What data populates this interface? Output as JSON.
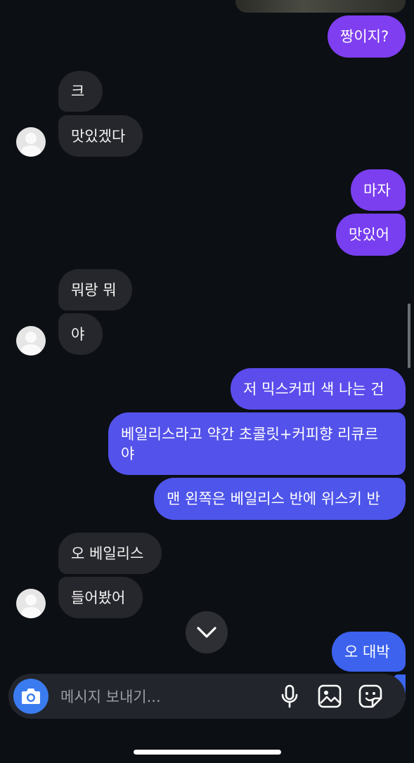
{
  "messages": [
    {
      "text": "짱이지?"
    },
    {
      "text": "크"
    },
    {
      "text": "맛있겠다"
    },
    {
      "text": "마자"
    },
    {
      "text": "맛있어"
    },
    {
      "text": "뭐랑 뭐"
    },
    {
      "text": "야"
    },
    {
      "text": "저 믹스커피 색 나는 건"
    },
    {
      "text": "베일리스라고 약간 초콜릿+커피향 리큐르\n야"
    },
    {
      "text": "맨 왼쪽은 베일리스 반에 위스키 반"
    },
    {
      "text": "오 베일리스"
    },
    {
      "text": "들어봤어"
    },
    {
      "text": "오 대박"
    }
  ],
  "composer": {
    "placeholder": "메시지 보내기..."
  },
  "colors": {
    "outgoing_purple": "#7e3ff0",
    "outgoing_blue": "#4e55ea",
    "incoming": "#26272c",
    "background": "#0c0f14",
    "camera_button": "#3a7cf0"
  }
}
